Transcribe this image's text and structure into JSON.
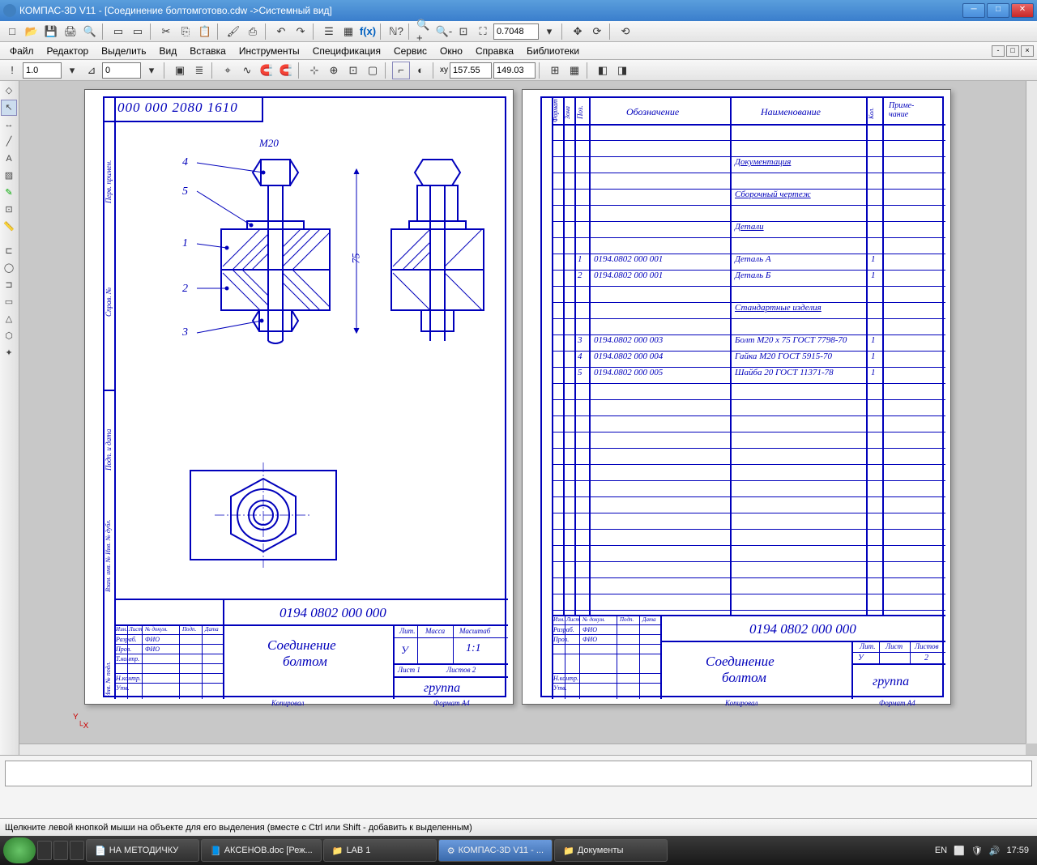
{
  "titlebar": {
    "app": "КОМПАС-3D V11",
    "doc": "[Соединение болтомготово.cdw ->Системный вид]"
  },
  "menu": [
    "Файл",
    "Редактор",
    "Выделить",
    "Вид",
    "Вставка",
    "Инструменты",
    "Спецификация",
    "Сервис",
    "Окно",
    "Справка",
    "Библиотеки"
  ],
  "toolbar2": {
    "zoom_value": "0.7048",
    "scale1": "1.0",
    "scale2": "0",
    "coord_x": "157.55",
    "coord_y": "149.03"
  },
  "sheet1": {
    "top_code": "000 000 2080 1610",
    "dim_m20": "М20",
    "dim_75": "75",
    "pos_labels": [
      "1",
      "2",
      "3",
      "4",
      "5"
    ],
    "tb_code": "0194 0802 000 000",
    "tb_name1": "Соединение",
    "tb_name2": "болтом",
    "tb_group": "группа",
    "tb_scale": "1:1",
    "tb_list": "Лист   1",
    "tb_listov": "Листов   2",
    "tb_lit": "Лит.",
    "tb_massa": "Масса",
    "tb_masht": "Масштаб",
    "tb_izm": "Изм.",
    "tb_list2": "Лист",
    "tb_ndok": "№ докум.",
    "tb_podp": "Подп.",
    "tb_data": "Дата",
    "tb_razrab": "Разраб.",
    "tb_prov": "Пров.",
    "tb_tkontr": "Т.контр.",
    "tb_nkontr": "Н.контр.",
    "tb_utv": "Утв.",
    "tb_fio": "ФИО",
    "tb_kopiroval": "Копировал",
    "tb_format": "Формат   А4",
    "tb_u": "У",
    "side_perv": "Перв. примен.",
    "side_sprav": "Справ. №",
    "side_podp_data": "Подп. и дата",
    "side_inv_dubl": "Взам. инв. № Инв. № дубл.",
    "side_inv_podl": "Инв. № подл."
  },
  "sheet2": {
    "headers": {
      "format": "Формат",
      "zona": "Зона",
      "poz": "Поз.",
      "oboz": "Обозначение",
      "naim": "Наименование",
      "kol": "Кол.",
      "prim": "Приме-\nчание"
    },
    "rows": [
      {
        "poz": "",
        "oboz": "",
        "naim": "Документация",
        "kol": ""
      },
      {
        "poz": "",
        "oboz": "",
        "naim": "Сборочный чертеж",
        "kol": ""
      },
      {
        "poz": "",
        "oboz": "",
        "naim": "Детали",
        "kol": ""
      },
      {
        "poz": "1",
        "oboz": "0194.0802 000 001",
        "naim": "Деталь А",
        "kol": "1"
      },
      {
        "poz": "2",
        "oboz": "0194.0802 000 001",
        "naim": "Деталь Б",
        "kol": "1"
      },
      {
        "poz": "",
        "oboz": "",
        "naim": "Стандартные изделия",
        "kol": ""
      },
      {
        "poz": "3",
        "oboz": "0194.0802 000 003",
        "naim": "Болт М20 x 75 ГОСТ 7798-70",
        "kol": "1"
      },
      {
        "poz": "4",
        "oboz": "0194.0802 000 004",
        "naim": "Гайка М20 ГОСТ 5915-70",
        "kol": "1"
      },
      {
        "poz": "5",
        "oboz": "0194.0802 000 005",
        "naim": "Шайба 20 ГОСТ 11371-78",
        "kol": "1"
      }
    ],
    "tb_code": "0194 0802 000 000",
    "tb_name1": "Соединение",
    "tb_name2": "болтом",
    "tb_group": "группа",
    "tb_lit": "Лит.",
    "tb_list": "Лист",
    "tb_listov": "Листов",
    "tb_u": "У",
    "tb_list_n": "",
    "tb_listov_n": "2",
    "tb_izm": "Изм.",
    "tb_list2": "Лист",
    "tb_ndok": "№ докум.",
    "tb_podp": "Подп.",
    "tb_data": "Дата",
    "tb_razrab": "Разраб.",
    "tb_prov": "Пров.",
    "tb_nkontr": "Н.контр.",
    "tb_utv": "Утв.",
    "tb_fio": "ФИО",
    "tb_kopiroval": "Копировал",
    "tb_format": "Формат   А4"
  },
  "statusbar": {
    "hint": "Щелкните левой кнопкой мыши на объекте для его выделения (вместе с Ctrl или Shift - добавить к выделенным)"
  },
  "taskbar": {
    "items": [
      "НА МЕТОДИЧКУ",
      "АКСЕНОВ.doc [Реж...",
      "LAB 1",
      "КОМПАС-3D V11 - ...",
      "Документы"
    ],
    "lang": "EN",
    "time": "17:59"
  }
}
